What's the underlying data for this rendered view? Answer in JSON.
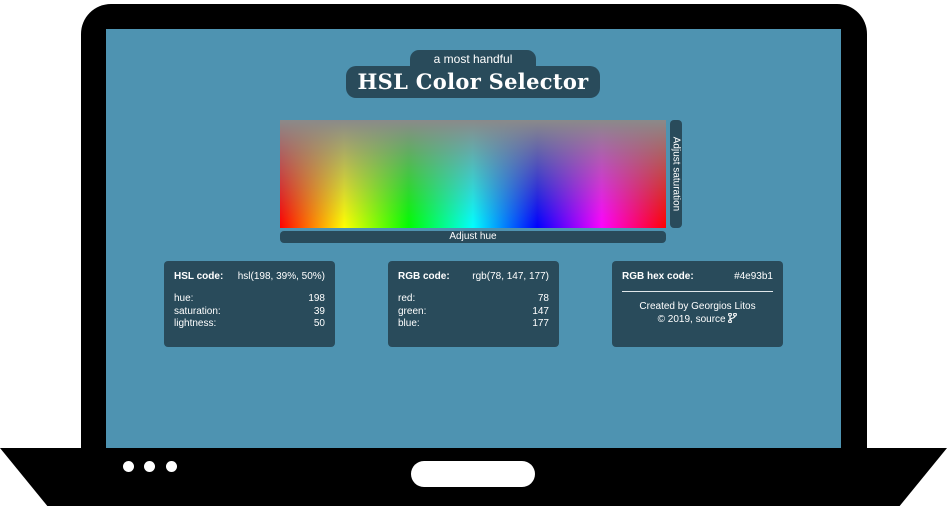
{
  "header": {
    "subtitle": "a most handful",
    "title": "HSL Color Selector"
  },
  "picker": {
    "saturation_label": "Adjust saturation",
    "hue_label": "Adjust hue"
  },
  "hsl_card": {
    "heading": "HSL code:",
    "code": "hsl(198, 39%, 50%)",
    "rows": [
      {
        "label": "hue:",
        "value": "198"
      },
      {
        "label": "saturation:",
        "value": "39"
      },
      {
        "label": "lightness:",
        "value": "50"
      }
    ]
  },
  "rgb_card": {
    "heading": "RGB code:",
    "code": "rgb(78, 147, 177)",
    "rows": [
      {
        "label": "red:",
        "value": "78"
      },
      {
        "label": "green:",
        "value": "147"
      },
      {
        "label": "blue:",
        "value": "177"
      }
    ]
  },
  "hex_card": {
    "heading": "RGB hex code:",
    "code": "#4e93b1",
    "credit_line": "Created by Georgios Litos",
    "copyright_line": "© 2019, source"
  },
  "colors": {
    "screen_background": "#4e93b1",
    "panel": "#294b5b",
    "laptop_frame": "#000000"
  },
  "icons": {
    "source_link": "git-branch-icon"
  }
}
